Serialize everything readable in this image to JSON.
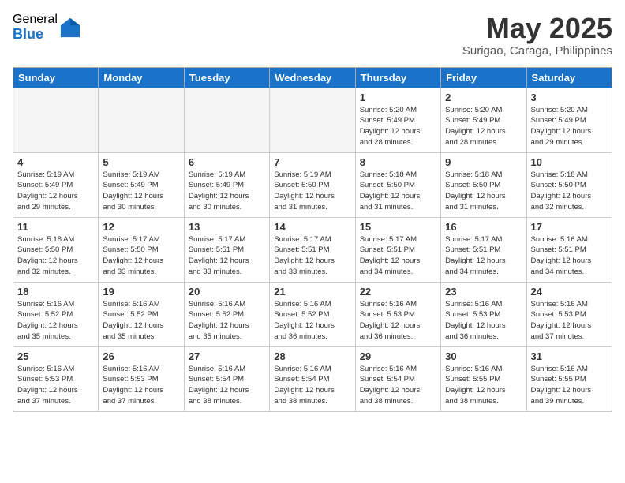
{
  "logo": {
    "general": "General",
    "blue": "Blue"
  },
  "header": {
    "month": "May 2025",
    "location": "Surigao, Caraga, Philippines"
  },
  "days": [
    "Sunday",
    "Monday",
    "Tuesday",
    "Wednesday",
    "Thursday",
    "Friday",
    "Saturday"
  ],
  "weeks": [
    [
      {
        "empty": true
      },
      {
        "empty": true
      },
      {
        "empty": true
      },
      {
        "empty": true
      },
      {
        "day": 1,
        "sunrise": "5:20 AM",
        "sunset": "5:49 PM",
        "daylight": "12 hours and 28 minutes."
      },
      {
        "day": 2,
        "sunrise": "5:20 AM",
        "sunset": "5:49 PM",
        "daylight": "12 hours and 28 minutes."
      },
      {
        "day": 3,
        "sunrise": "5:20 AM",
        "sunset": "5:49 PM",
        "daylight": "12 hours and 29 minutes."
      }
    ],
    [
      {
        "day": 4,
        "sunrise": "5:19 AM",
        "sunset": "5:49 PM",
        "daylight": "12 hours and 29 minutes."
      },
      {
        "day": 5,
        "sunrise": "5:19 AM",
        "sunset": "5:49 PM",
        "daylight": "12 hours and 30 minutes."
      },
      {
        "day": 6,
        "sunrise": "5:19 AM",
        "sunset": "5:49 PM",
        "daylight": "12 hours and 30 minutes."
      },
      {
        "day": 7,
        "sunrise": "5:19 AM",
        "sunset": "5:50 PM",
        "daylight": "12 hours and 31 minutes."
      },
      {
        "day": 8,
        "sunrise": "5:18 AM",
        "sunset": "5:50 PM",
        "daylight": "12 hours and 31 minutes."
      },
      {
        "day": 9,
        "sunrise": "5:18 AM",
        "sunset": "5:50 PM",
        "daylight": "12 hours and 31 minutes."
      },
      {
        "day": 10,
        "sunrise": "5:18 AM",
        "sunset": "5:50 PM",
        "daylight": "12 hours and 32 minutes."
      }
    ],
    [
      {
        "day": 11,
        "sunrise": "5:18 AM",
        "sunset": "5:50 PM",
        "daylight": "12 hours and 32 minutes."
      },
      {
        "day": 12,
        "sunrise": "5:17 AM",
        "sunset": "5:50 PM",
        "daylight": "12 hours and 33 minutes."
      },
      {
        "day": 13,
        "sunrise": "5:17 AM",
        "sunset": "5:51 PM",
        "daylight": "12 hours and 33 minutes."
      },
      {
        "day": 14,
        "sunrise": "5:17 AM",
        "sunset": "5:51 PM",
        "daylight": "12 hours and 33 minutes."
      },
      {
        "day": 15,
        "sunrise": "5:17 AM",
        "sunset": "5:51 PM",
        "daylight": "12 hours and 34 minutes."
      },
      {
        "day": 16,
        "sunrise": "5:17 AM",
        "sunset": "5:51 PM",
        "daylight": "12 hours and 34 minutes."
      },
      {
        "day": 17,
        "sunrise": "5:16 AM",
        "sunset": "5:51 PM",
        "daylight": "12 hours and 34 minutes."
      }
    ],
    [
      {
        "day": 18,
        "sunrise": "5:16 AM",
        "sunset": "5:52 PM",
        "daylight": "12 hours and 35 minutes."
      },
      {
        "day": 19,
        "sunrise": "5:16 AM",
        "sunset": "5:52 PM",
        "daylight": "12 hours and 35 minutes."
      },
      {
        "day": 20,
        "sunrise": "5:16 AM",
        "sunset": "5:52 PM",
        "daylight": "12 hours and 35 minutes."
      },
      {
        "day": 21,
        "sunrise": "5:16 AM",
        "sunset": "5:52 PM",
        "daylight": "12 hours and 36 minutes."
      },
      {
        "day": 22,
        "sunrise": "5:16 AM",
        "sunset": "5:53 PM",
        "daylight": "12 hours and 36 minutes."
      },
      {
        "day": 23,
        "sunrise": "5:16 AM",
        "sunset": "5:53 PM",
        "daylight": "12 hours and 36 minutes."
      },
      {
        "day": 24,
        "sunrise": "5:16 AM",
        "sunset": "5:53 PM",
        "daylight": "12 hours and 37 minutes."
      }
    ],
    [
      {
        "day": 25,
        "sunrise": "5:16 AM",
        "sunset": "5:53 PM",
        "daylight": "12 hours and 37 minutes."
      },
      {
        "day": 26,
        "sunrise": "5:16 AM",
        "sunset": "5:53 PM",
        "daylight": "12 hours and 37 minutes."
      },
      {
        "day": 27,
        "sunrise": "5:16 AM",
        "sunset": "5:54 PM",
        "daylight": "12 hours and 38 minutes."
      },
      {
        "day": 28,
        "sunrise": "5:16 AM",
        "sunset": "5:54 PM",
        "daylight": "12 hours and 38 minutes."
      },
      {
        "day": 29,
        "sunrise": "5:16 AM",
        "sunset": "5:54 PM",
        "daylight": "12 hours and 38 minutes."
      },
      {
        "day": 30,
        "sunrise": "5:16 AM",
        "sunset": "5:55 PM",
        "daylight": "12 hours and 38 minutes."
      },
      {
        "day": 31,
        "sunrise": "5:16 AM",
        "sunset": "5:55 PM",
        "daylight": "12 hours and 39 minutes."
      }
    ]
  ]
}
